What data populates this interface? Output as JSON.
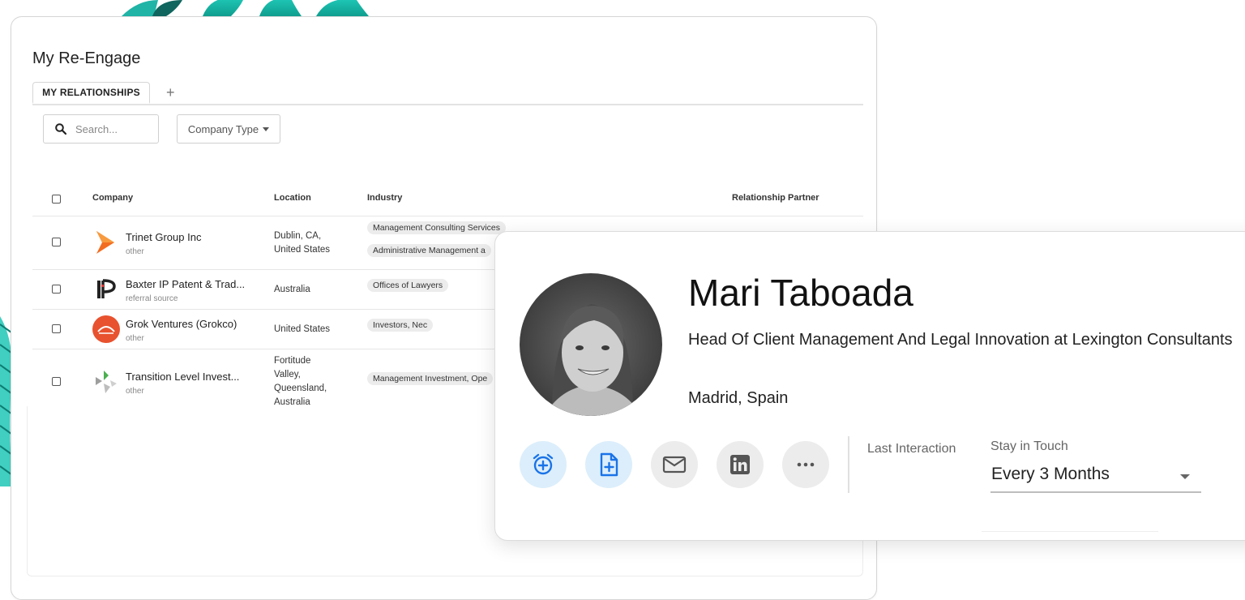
{
  "page": {
    "title": "My Re-Engage"
  },
  "tabs": [
    {
      "label": "MY RELATIONSHIPS"
    },
    {
      "label": "+"
    }
  ],
  "search": {
    "placeholder": "Search..."
  },
  "filters": {
    "company_type": "Company Type"
  },
  "table": {
    "columns": [
      "Company",
      "Location",
      "Industry",
      "Relationship Partner"
    ],
    "rows": [
      {
        "name": "Trinet Group Inc",
        "type": "other",
        "location": "Dublin, CA,\nUnited States",
        "industries": [
          "Management Consulting Services",
          "Administrative Management a"
        ]
      },
      {
        "name": "Baxter IP Patent & Trad...",
        "type": "referral source",
        "location": "Australia",
        "industries": [
          "Offices of Lawyers"
        ]
      },
      {
        "name": "Grok Ventures (Grokco)",
        "type": "other",
        "location": "United States",
        "industries": [
          "Investors, Nec"
        ]
      },
      {
        "name": "Transition Level Invest...",
        "type": "other",
        "location": "Fortitude\nValley,\nQueensland,\nAustralia",
        "industries": [
          "Management Investment, Ope"
        ]
      }
    ]
  },
  "profile": {
    "name": "Mari Taboada",
    "title": "Head Of Client Management And Legal Innovation at Lexington Consultants",
    "location": "Madrid, Spain",
    "last_interaction_label": "Last Interaction",
    "stay_in_touch_label": "Stay in Touch",
    "stay_in_touch_value": "Every 3 Months",
    "actions": [
      "alarm-add-icon",
      "note-add-icon",
      "email-icon",
      "linkedin-icon",
      "more-icon"
    ]
  },
  "colors": {
    "leaf_teal": "#1fc7b6",
    "leaf_dark": "#10655e",
    "action_blue_bg": "#dceefb",
    "action_blue_icon": "#1a73e8",
    "trinet_orange": "#f26d21",
    "grok_red": "#e8522e",
    "baxter_red": "#e53935"
  }
}
